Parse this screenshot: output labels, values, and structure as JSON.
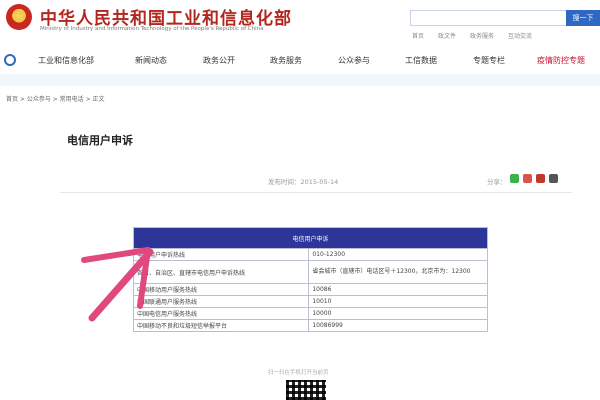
{
  "header": {
    "title": "中华人民共和国工业和信息化部",
    "subtitle": "Ministry of Industry and Information Technology of the People's Republic of China",
    "search_placeholder": "",
    "search_button": "搜一下",
    "links": [
      "首页",
      "政文件",
      "政务服务",
      "互动交流"
    ]
  },
  "nav": {
    "items": [
      "工业和信息化部",
      "新闻动态",
      "政务公开",
      "政务服务",
      "公众参与",
      "工信数据",
      "专题专栏",
      "疫情防控专题"
    ],
    "highlight_color": "#c8102e"
  },
  "breadcrumb": "首页 > 公众参与 > 常用电话 > 正文",
  "article": {
    "title": "电信用户申诉",
    "date": "发布时间：2015-05-14",
    "share_label": "分享："
  },
  "table": {
    "header": "电信用户申诉",
    "rows": [
      {
        "label": "电信用户申诉热线",
        "value": "010-12300",
        "tall": false
      },
      {
        "label": "各省、自治区、直辖市电信用户申诉热线",
        "value": "省会城市（直辖市）电话区号＋12300，北京市为：12300",
        "tall": true
      },
      {
        "label": "中国移动用户服务热线",
        "value": "10086",
        "tall": false
      },
      {
        "label": "中国联通用户服务热线",
        "value": "10010",
        "tall": false
      },
      {
        "label": "中国电信用户服务热线",
        "value": "10000",
        "tall": false
      },
      {
        "label": "中国移动不良和垃圾短信举报平台",
        "value": "10086999",
        "tall": false
      }
    ]
  },
  "footer": {
    "note": "扫一扫在手机打开当前页"
  },
  "colors": {
    "brand_red": "#b3261e",
    "table_header": "#2d3599",
    "search_button": "#2e68c3",
    "arrow": "#e0487f"
  }
}
